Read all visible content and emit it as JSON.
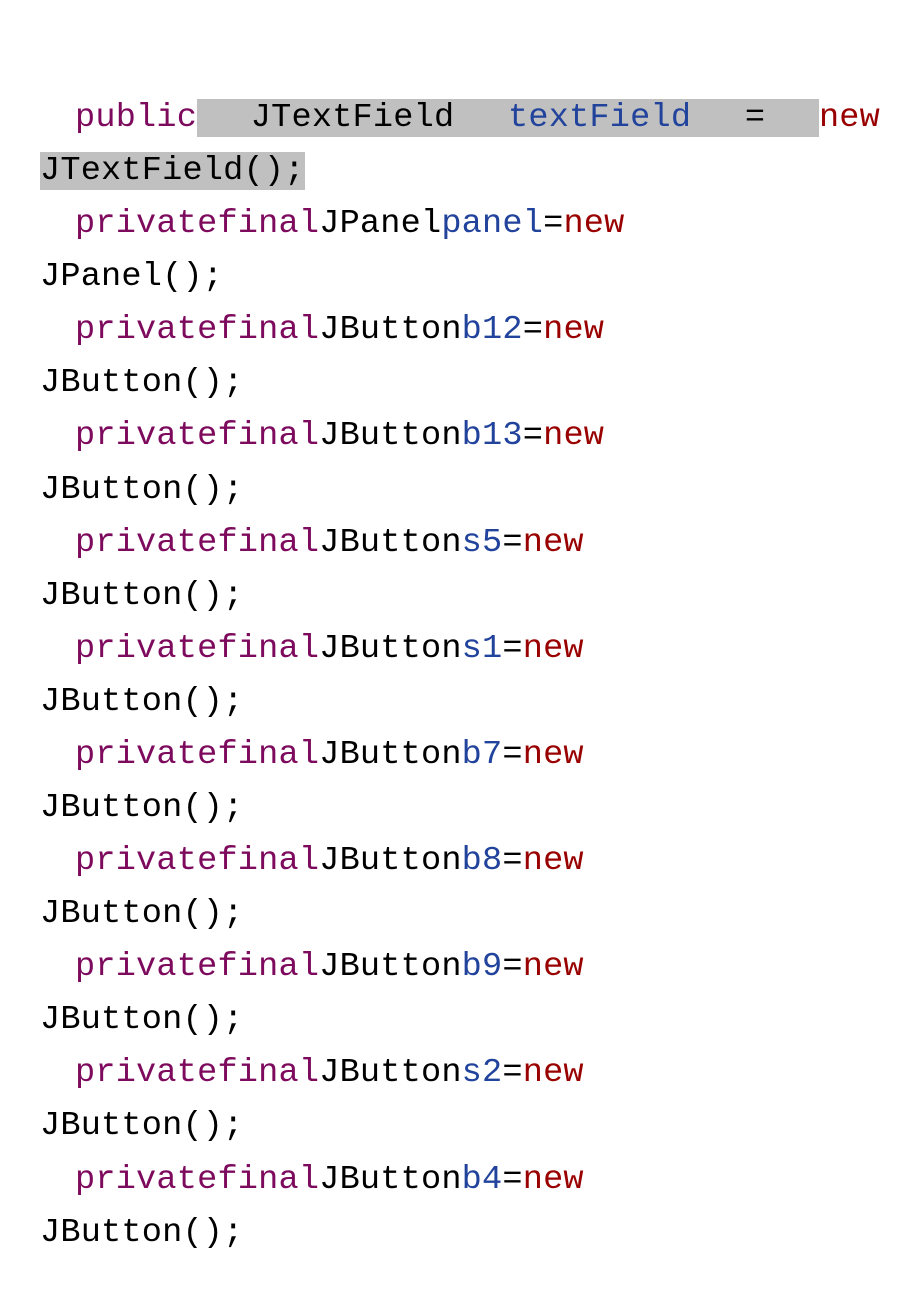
{
  "lines": [
    {
      "indent": true,
      "justify": true,
      "tokens": [
        {
          "t": "public",
          "c": "kw1",
          "hl": false
        },
        {
          "t": " ",
          "c": "sp",
          "hl": false
        },
        {
          "t": " JTextField ",
          "c": "txt",
          "hl": true
        },
        {
          "t": "textField",
          "c": "id",
          "hl": true
        },
        {
          "t": " = ",
          "c": "txt",
          "hl": true
        },
        {
          "t": "new",
          "c": "kw2",
          "hl": false
        }
      ]
    },
    {
      "indent": false,
      "justify": false,
      "tokens": [
        {
          "t": "JTextField();",
          "c": "txt",
          "hl": true
        }
      ]
    },
    {
      "indent": true,
      "justify": true,
      "tokens": [
        {
          "t": "private",
          "c": "kw1"
        },
        {
          "t": " ",
          "c": "sp"
        },
        {
          "t": "final",
          "c": "kw1"
        },
        {
          "t": " ",
          "c": "sp"
        },
        {
          "t": "JPanel",
          "c": "txt"
        },
        {
          "t": " ",
          "c": "sp"
        },
        {
          "t": "panel",
          "c": "id"
        },
        {
          "t": " ",
          "c": "sp"
        },
        {
          "t": "=",
          "c": "txt"
        },
        {
          "t": " ",
          "c": "sp"
        },
        {
          "t": "new",
          "c": "kw2"
        }
      ]
    },
    {
      "indent": false,
      "justify": false,
      "tokens": [
        {
          "t": "JPanel();",
          "c": "txt"
        }
      ]
    },
    {
      "indent": true,
      "justify": true,
      "tokens": [
        {
          "t": "private",
          "c": "kw1"
        },
        {
          "t": " ",
          "c": "sp"
        },
        {
          "t": "final",
          "c": "kw1"
        },
        {
          "t": " ",
          "c": "sp"
        },
        {
          "t": "JButton",
          "c": "txt"
        },
        {
          "t": " ",
          "c": "sp"
        },
        {
          "t": "b12",
          "c": "id"
        },
        {
          "t": " ",
          "c": "sp"
        },
        {
          "t": "=",
          "c": "txt"
        },
        {
          "t": " ",
          "c": "sp"
        },
        {
          "t": "new",
          "c": "kw2"
        }
      ]
    },
    {
      "indent": false,
      "justify": false,
      "tokens": [
        {
          "t": "JButton();",
          "c": "txt"
        }
      ]
    },
    {
      "indent": true,
      "justify": true,
      "tokens": [
        {
          "t": "private",
          "c": "kw1"
        },
        {
          "t": " ",
          "c": "sp"
        },
        {
          "t": "final",
          "c": "kw1"
        },
        {
          "t": " ",
          "c": "sp"
        },
        {
          "t": "JButton",
          "c": "txt"
        },
        {
          "t": " ",
          "c": "sp"
        },
        {
          "t": "b13",
          "c": "id"
        },
        {
          "t": " ",
          "c": "sp"
        },
        {
          "t": "=",
          "c": "txt"
        },
        {
          "t": " ",
          "c": "sp"
        },
        {
          "t": "new",
          "c": "kw2"
        }
      ]
    },
    {
      "indent": false,
      "justify": false,
      "tokens": [
        {
          "t": "JButton();",
          "c": "txt"
        }
      ]
    },
    {
      "indent": true,
      "justify": true,
      "tokens": [
        {
          "t": "private",
          "c": "kw1"
        },
        {
          "t": " ",
          "c": "sp"
        },
        {
          "t": "final",
          "c": "kw1"
        },
        {
          "t": " ",
          "c": "sp"
        },
        {
          "t": "JButton",
          "c": "txt"
        },
        {
          "t": " ",
          "c": "sp"
        },
        {
          "t": "s5",
          "c": "id"
        },
        {
          "t": " ",
          "c": "sp"
        },
        {
          "t": "=",
          "c": "txt"
        },
        {
          "t": " ",
          "c": "sp"
        },
        {
          "t": "new",
          "c": "kw2"
        }
      ]
    },
    {
      "indent": false,
      "justify": false,
      "tokens": [
        {
          "t": "JButton();",
          "c": "txt"
        }
      ]
    },
    {
      "indent": true,
      "justify": true,
      "tokens": [
        {
          "t": "private",
          "c": "kw1"
        },
        {
          "t": " ",
          "c": "sp"
        },
        {
          "t": "final",
          "c": "kw1"
        },
        {
          "t": " ",
          "c": "sp"
        },
        {
          "t": "JButton",
          "c": "txt"
        },
        {
          "t": " ",
          "c": "sp"
        },
        {
          "t": "s1",
          "c": "id"
        },
        {
          "t": " ",
          "c": "sp"
        },
        {
          "t": "=",
          "c": "txt"
        },
        {
          "t": " ",
          "c": "sp"
        },
        {
          "t": "new",
          "c": "kw2"
        }
      ]
    },
    {
      "indent": false,
      "justify": false,
      "tokens": [
        {
          "t": "JButton();",
          "c": "txt"
        }
      ]
    },
    {
      "indent": true,
      "justify": true,
      "tokens": [
        {
          "t": "private",
          "c": "kw1"
        },
        {
          "t": " ",
          "c": "sp"
        },
        {
          "t": "final",
          "c": "kw1"
        },
        {
          "t": " ",
          "c": "sp"
        },
        {
          "t": "JButton",
          "c": "txt"
        },
        {
          "t": " ",
          "c": "sp"
        },
        {
          "t": "b7",
          "c": "id"
        },
        {
          "t": " ",
          "c": "sp"
        },
        {
          "t": "=",
          "c": "txt"
        },
        {
          "t": " ",
          "c": "sp"
        },
        {
          "t": "new",
          "c": "kw2"
        }
      ]
    },
    {
      "indent": false,
      "justify": false,
      "tokens": [
        {
          "t": "JButton();",
          "c": "txt"
        }
      ]
    },
    {
      "indent": true,
      "justify": true,
      "tokens": [
        {
          "t": "private",
          "c": "kw1"
        },
        {
          "t": " ",
          "c": "sp"
        },
        {
          "t": "final",
          "c": "kw1"
        },
        {
          "t": " ",
          "c": "sp"
        },
        {
          "t": "JButton",
          "c": "txt"
        },
        {
          "t": " ",
          "c": "sp"
        },
        {
          "t": "b8",
          "c": "id"
        },
        {
          "t": " ",
          "c": "sp"
        },
        {
          "t": "=",
          "c": "txt"
        },
        {
          "t": " ",
          "c": "sp"
        },
        {
          "t": "new",
          "c": "kw2"
        }
      ]
    },
    {
      "indent": false,
      "justify": false,
      "tokens": [
        {
          "t": "JButton();",
          "c": "txt"
        }
      ]
    },
    {
      "indent": true,
      "justify": true,
      "tokens": [
        {
          "t": "private",
          "c": "kw1"
        },
        {
          "t": " ",
          "c": "sp"
        },
        {
          "t": "final",
          "c": "kw1"
        },
        {
          "t": " ",
          "c": "sp"
        },
        {
          "t": "JButton",
          "c": "txt"
        },
        {
          "t": " ",
          "c": "sp"
        },
        {
          "t": "b9",
          "c": "id"
        },
        {
          "t": " ",
          "c": "sp"
        },
        {
          "t": "=",
          "c": "txt"
        },
        {
          "t": " ",
          "c": "sp"
        },
        {
          "t": "new",
          "c": "kw2"
        }
      ]
    },
    {
      "indent": false,
      "justify": false,
      "tokens": [
        {
          "t": "JButton();",
          "c": "txt"
        }
      ]
    },
    {
      "indent": true,
      "justify": true,
      "tokens": [
        {
          "t": "private",
          "c": "kw1"
        },
        {
          "t": " ",
          "c": "sp"
        },
        {
          "t": "final",
          "c": "kw1"
        },
        {
          "t": " ",
          "c": "sp"
        },
        {
          "t": "JButton",
          "c": "txt"
        },
        {
          "t": " ",
          "c": "sp"
        },
        {
          "t": "s2",
          "c": "id"
        },
        {
          "t": " ",
          "c": "sp"
        },
        {
          "t": "=",
          "c": "txt"
        },
        {
          "t": " ",
          "c": "sp"
        },
        {
          "t": "new",
          "c": "kw2"
        }
      ]
    },
    {
      "indent": false,
      "justify": false,
      "tokens": [
        {
          "t": "JButton();",
          "c": "txt"
        }
      ]
    },
    {
      "indent": true,
      "justify": true,
      "tokens": [
        {
          "t": "private",
          "c": "kw1"
        },
        {
          "t": " ",
          "c": "sp"
        },
        {
          "t": "final",
          "c": "kw1"
        },
        {
          "t": " ",
          "c": "sp"
        },
        {
          "t": "JButton",
          "c": "txt"
        },
        {
          "t": " ",
          "c": "sp"
        },
        {
          "t": "b4",
          "c": "id"
        },
        {
          "t": " ",
          "c": "sp"
        },
        {
          "t": "=",
          "c": "txt"
        },
        {
          "t": " ",
          "c": "sp"
        },
        {
          "t": "new",
          "c": "kw2"
        }
      ]
    },
    {
      "indent": false,
      "justify": false,
      "tokens": [
        {
          "t": "JButton();",
          "c": "txt"
        }
      ]
    }
  ]
}
